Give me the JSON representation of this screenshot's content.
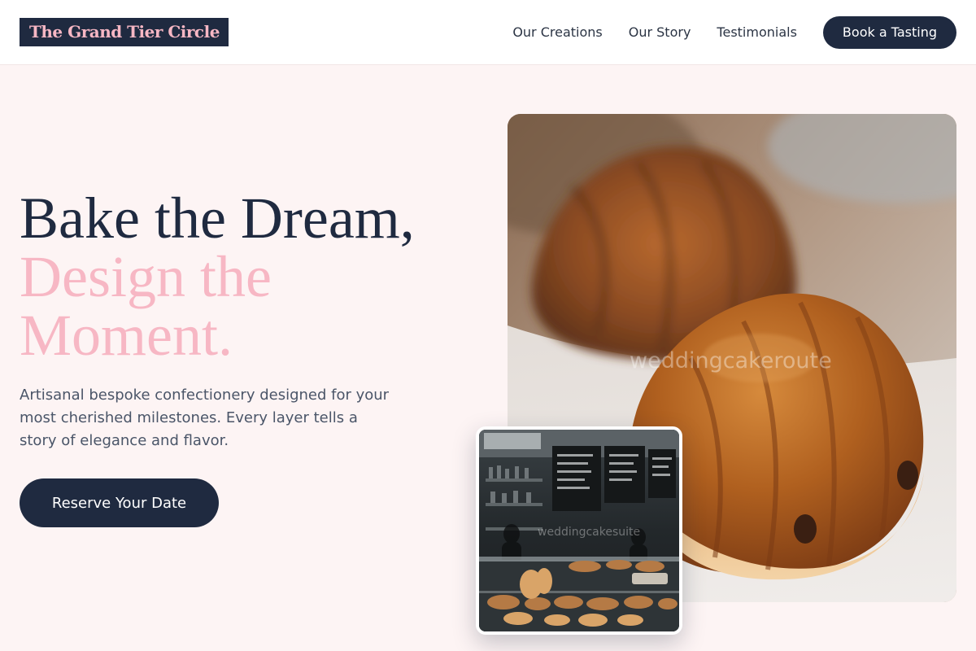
{
  "brand": {
    "name": "The Grand Tier Circle"
  },
  "nav": {
    "links": [
      {
        "label": "Our Creations"
      },
      {
        "label": "Our Story"
      },
      {
        "label": "Testimonials"
      }
    ],
    "cta_label": "Book a Tasting"
  },
  "hero": {
    "title_line1": "Bake the Dream,",
    "title_line2": "Design the",
    "title_line3": "Moment.",
    "subtitle": "Artisanal bespoke confectionery designed for your most cherished milestones. Every layer tells a story of elegance and flavor.",
    "button_label": "Reserve Your Date"
  },
  "images": {
    "main_watermark": "weddingcakeroute",
    "inset_watermark": "weddingcakesuite"
  },
  "colors": {
    "navy": "#1f2a40",
    "pink": "#f7b7c4",
    "background": "#fdf4f4",
    "body_text": "#4a5568"
  }
}
